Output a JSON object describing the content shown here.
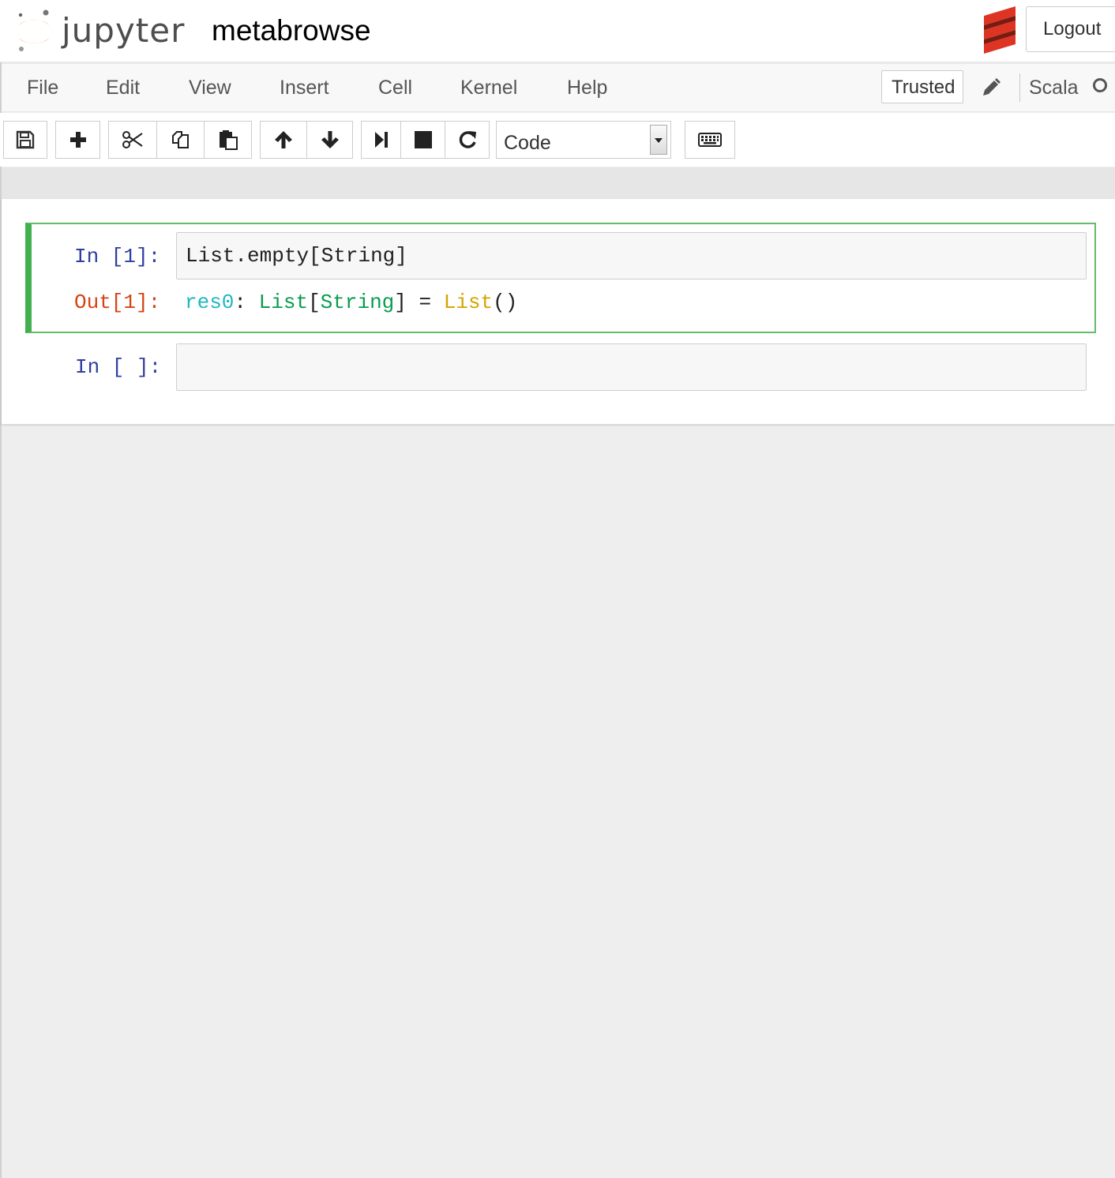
{
  "header": {
    "logo_text": "jupyter",
    "notebook_name": "metabrowse",
    "logout_label": "Logout",
    "kernel_logo_icon": "scala-logo-icon"
  },
  "menubar": {
    "items": [
      "File",
      "Edit",
      "View",
      "Insert",
      "Cell",
      "Kernel",
      "Help"
    ],
    "trusted_label": "Trusted",
    "kernel_name": "Scala"
  },
  "toolbar": {
    "buttons": [
      "save-icon",
      "insert-cell-below-icon",
      "cut-icon",
      "copy-icon",
      "paste-icon",
      "move-up-icon",
      "move-down-icon",
      "run-icon",
      "interrupt-icon",
      "restart-icon",
      "keyboard-icon"
    ],
    "cell_type": "Code"
  },
  "cells": [
    {
      "in_prompt": "In [1]:",
      "source": {
        "name": "List",
        "dot": ".",
        "method": "empty",
        "lbr": "[",
        "type": "String",
        "rbr": "]"
      },
      "out_prompt": "Out[1]:",
      "output": {
        "res": "res0",
        "colon": ": ",
        "type1": "List",
        "lbr": "[",
        "type2": "String",
        "rbr": "]",
        "eq": " = ",
        "ctor": "List",
        "parens": "()"
      }
    },
    {
      "in_prompt": "In [ ]:",
      "source": ""
    }
  ],
  "colors": {
    "selected_cell_border": "#66bb6a",
    "in_prompt": "#303f9f",
    "out_prompt": "#d84315",
    "jupyter_orange": "#f37726"
  }
}
